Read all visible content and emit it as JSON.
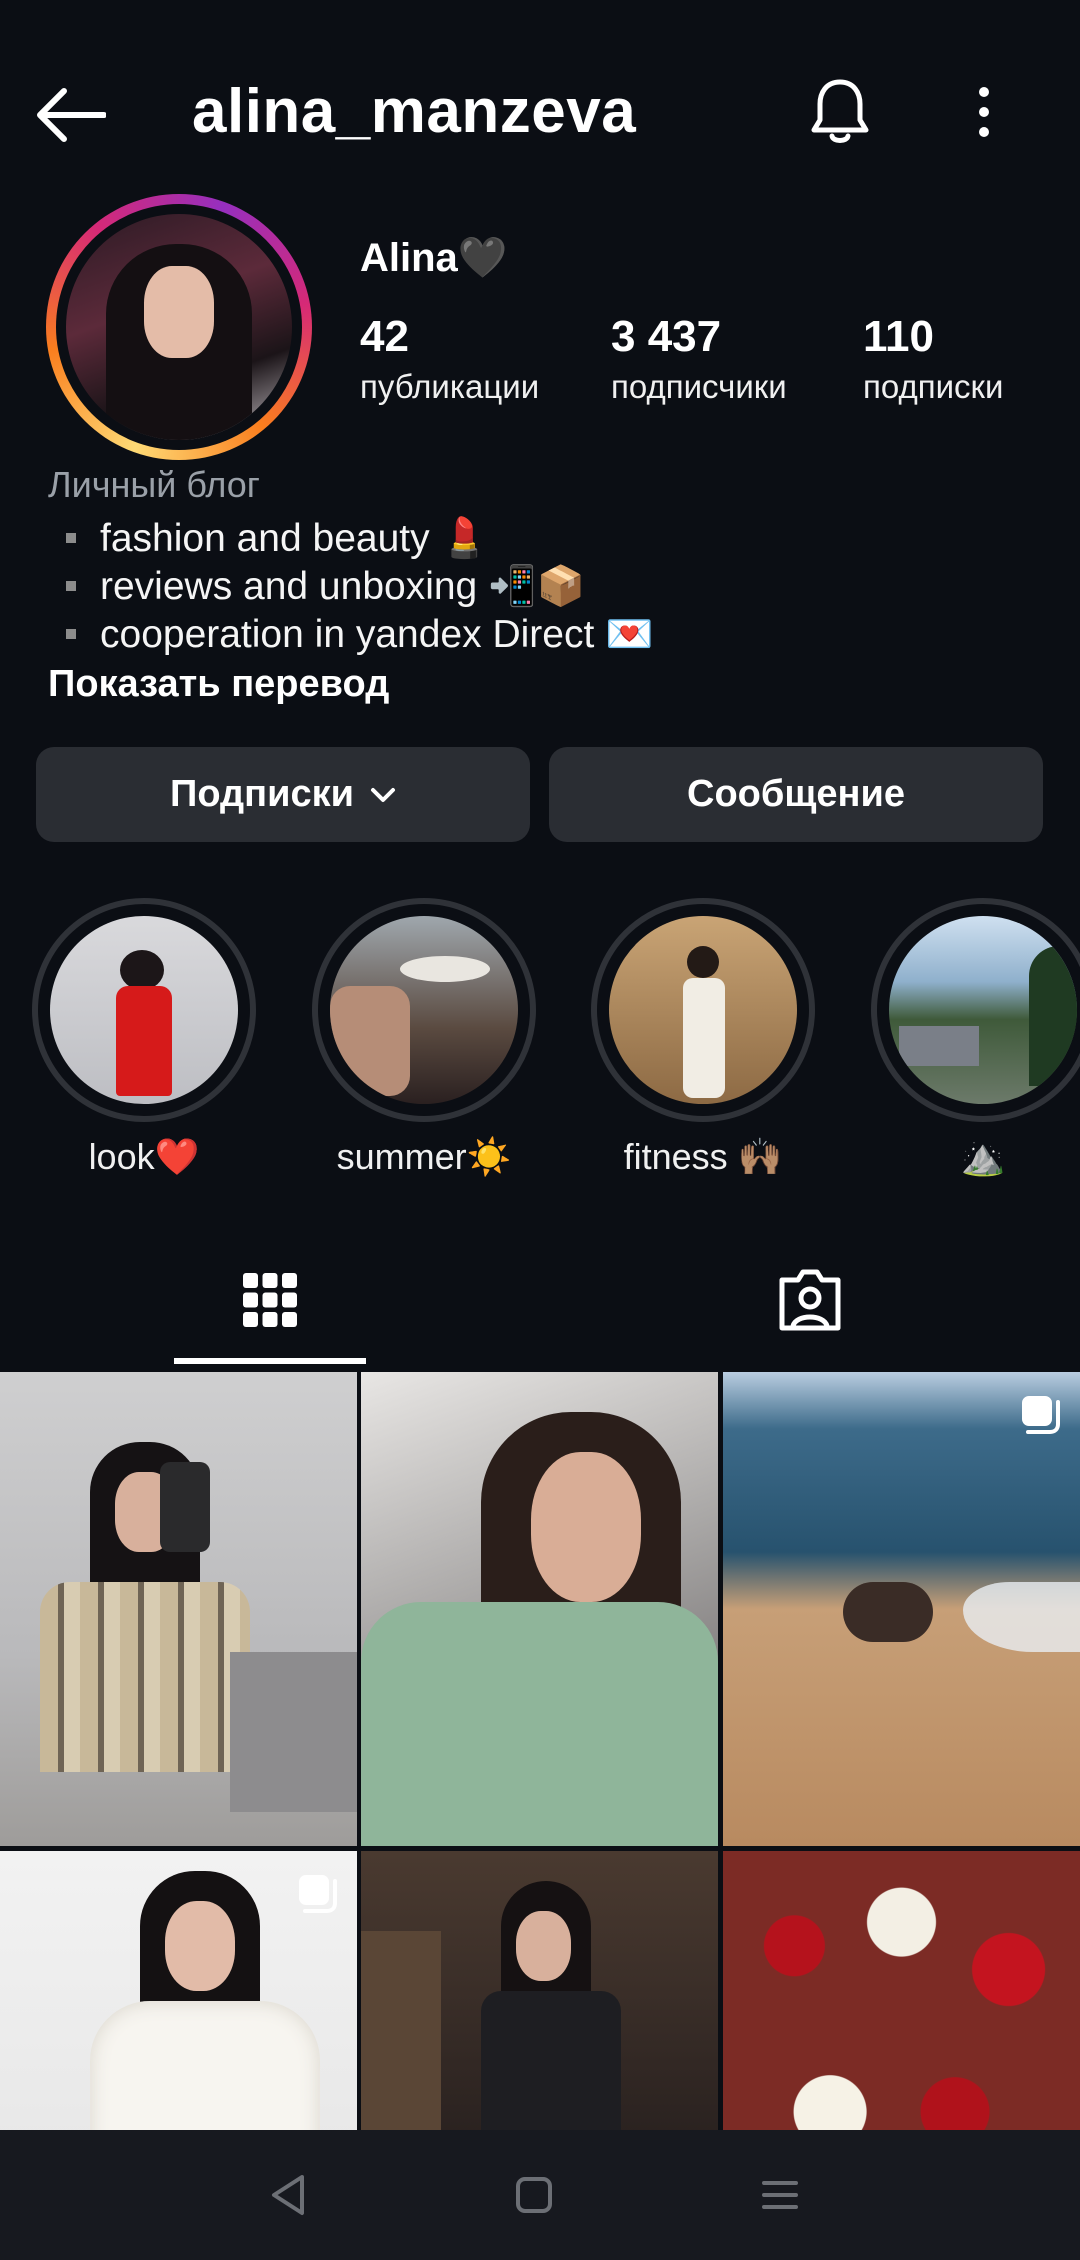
{
  "header": {
    "username": "alina_manzeva"
  },
  "profile": {
    "display_name": "Alina🖤",
    "stats": [
      {
        "value": "42",
        "label": "публикации"
      },
      {
        "value": "3 437",
        "label": "подписчики"
      },
      {
        "value": "110",
        "label": "подписки"
      }
    ],
    "category": "Личный блог",
    "bio": [
      "fashion and beauty 💄",
      "reviews and unboxing 📲📦",
      "cooperation in yandex Direct 💌"
    ],
    "show_translation": "Показать перевод"
  },
  "actions": {
    "following_label": "Подписки",
    "message_label": "Сообщение"
  },
  "highlights": [
    {
      "label": "look❤️"
    },
    {
      "label": "summer☀️"
    },
    {
      "label": "fitness 🙌🏽"
    },
    {
      "label": "⛰️"
    }
  ],
  "tabs": [
    {
      "icon": "grid-icon",
      "active": true
    },
    {
      "icon": "tagged-person-icon",
      "active": false
    }
  ],
  "colors": {
    "background": "#0b0e14",
    "button_bg": "#2a2d33",
    "secondary_text": "#9aa0a8"
  }
}
